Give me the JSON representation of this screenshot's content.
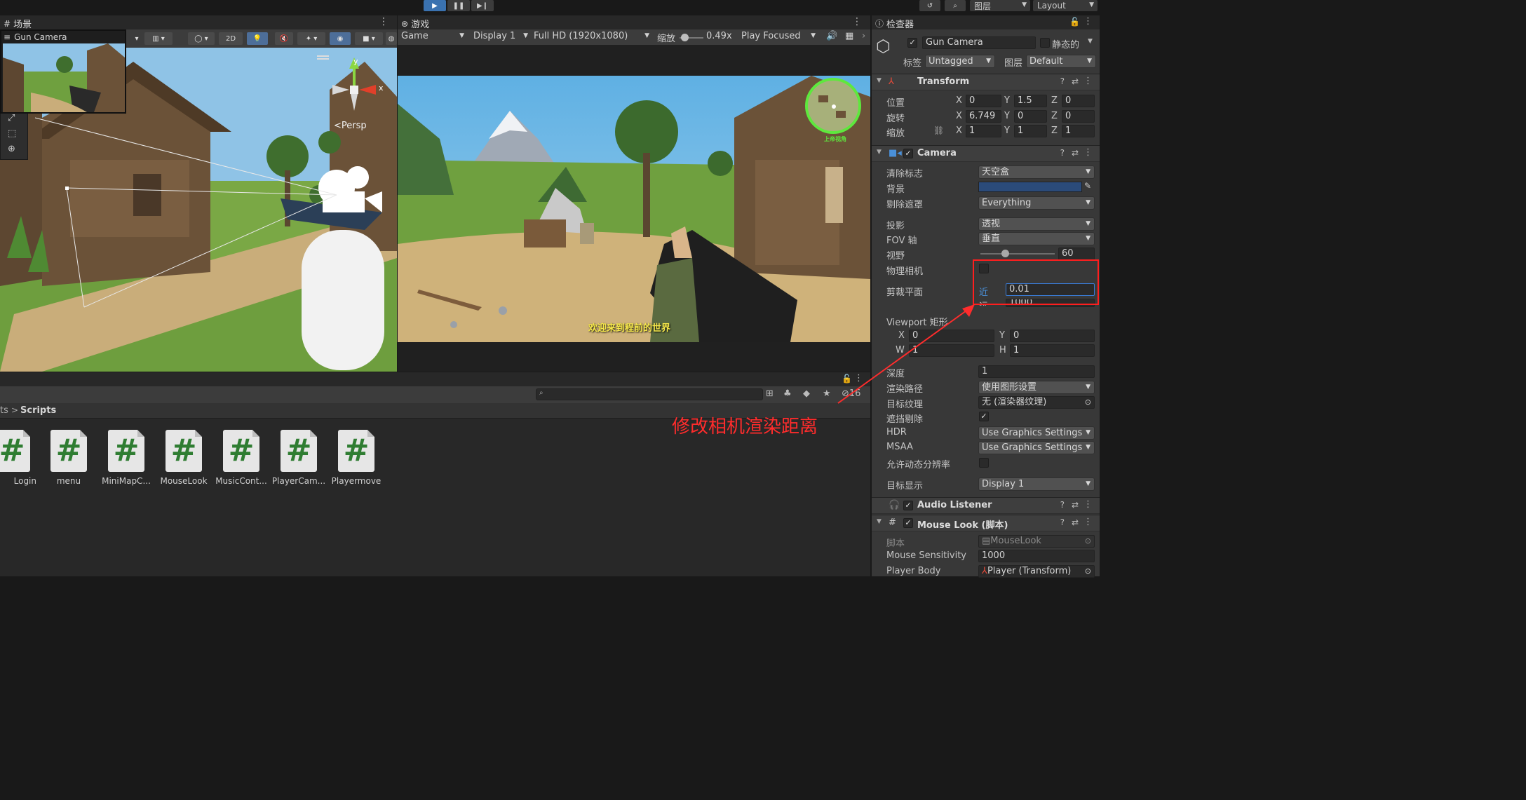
{
  "topbar": {
    "layers_label": "图层",
    "layout_label": "Layout"
  },
  "scene": {
    "tab_label": "场景",
    "camera_preview_label": "Gun Camera",
    "mode_2d": "2D",
    "persp_label": "Persp",
    "gizmo_y": "y",
    "gizmo_x": "x"
  },
  "game": {
    "tab_label": "游戏",
    "mode": "Game",
    "display": "Display 1",
    "resolution": "Full HD (1920x1080)",
    "scale_label": "缩放",
    "scale_value": "0.49x",
    "play_mode": "Play Focused",
    "subtitle": "欢迎来到程前的世界",
    "minimap_label": "上帝视角"
  },
  "project": {
    "breadcrumb_root": "ts",
    "breadcrumb_sep": ">",
    "breadcrumb_current": "Scripts",
    "hidden_count": "16",
    "assets": [
      {
        "label": "Login"
      },
      {
        "label": "menu"
      },
      {
        "label": "MiniMapC..."
      },
      {
        "label": "MouseLook"
      },
      {
        "label": "MusicCont..."
      },
      {
        "label": "PlayerCam..."
      },
      {
        "label": "Playermove"
      }
    ]
  },
  "inspector": {
    "tab_label": "检查器",
    "object_name": "Gun Camera",
    "static_label": "静态的",
    "tag_label": "标签",
    "tag_value": "Untagged",
    "layer_label": "图层",
    "layer_value": "Default",
    "transform": {
      "title": "Transform",
      "position_label": "位置",
      "rotation_label": "旋转",
      "scale_label": "缩放",
      "position": {
        "x": "0",
        "y": "1.5",
        "z": "0"
      },
      "rotation": {
        "x": "6.749",
        "y": "0",
        "z": "0"
      },
      "scale": {
        "x": "1",
        "y": "1",
        "z": "1"
      }
    },
    "camera": {
      "title": "Camera",
      "clear_flags_label": "清除标志",
      "clear_flags_value": "天空盒",
      "background_label": "背景",
      "background_color": "#2b4b7a",
      "culling_label": "剔除遮罩",
      "culling_value": "Everything",
      "projection_label": "投影",
      "projection_value": "透视",
      "fov_axis_label": "FOV 轴",
      "fov_axis_value": "垂直",
      "fov_label": "视野",
      "fov_value": "60",
      "physical_label": "物理相机",
      "clip_label": "剪裁平面",
      "near_label": "近",
      "near_value": "0.01",
      "far_label": "远",
      "far_value": "1000",
      "viewport_label": "Viewport 矩形",
      "vp_x": "0",
      "vp_y": "0",
      "vp_w": "1",
      "vp_h": "1",
      "depth_label": "深度",
      "depth_value": "1",
      "render_path_label": "渲染路径",
      "render_path_value": "使用图形设置",
      "target_texture_label": "目标纹理",
      "target_texture_value": "无 (渲染器纹理)",
      "occlusion_label": "遮挡剔除",
      "hdr_label": "HDR",
      "hdr_value": "Use Graphics Settings",
      "msaa_label": "MSAA",
      "msaa_value": "Use Graphics Settings",
      "dynres_label": "允许动态分辨率",
      "target_display_label": "目标显示",
      "target_display_value": "Display 1"
    },
    "audio_listener": {
      "title": "Audio Listener"
    },
    "mouse_look": {
      "title": "Mouse Look  (脚本)",
      "script_label": "脚本",
      "script_value": "MouseLook",
      "sensitivity_label": "Mouse Sensitivity",
      "sensitivity_value": "1000",
      "player_body_label": "Player Body",
      "player_body_value": "Player (Transform)"
    }
  },
  "annotation": {
    "note": "修改相机渲染距离",
    "color": "#ff2c2c"
  }
}
